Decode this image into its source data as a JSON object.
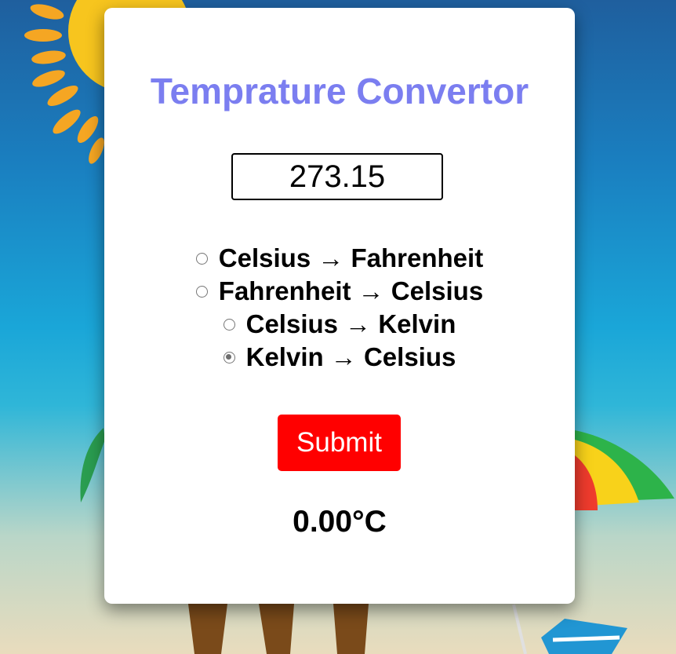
{
  "app": {
    "title": "Temprature Convertor"
  },
  "input": {
    "value": "273.15"
  },
  "options": [
    {
      "label": "Celsius → Fahrenheit",
      "checked": false
    },
    {
      "label": "Fahrenheit → Celsius",
      "checked": false
    },
    {
      "label": "Celsius → Kelvin",
      "checked": false
    },
    {
      "label": "Kelvin → Celsius",
      "checked": true
    }
  ],
  "submit": {
    "label": "Submit"
  },
  "result": {
    "text": "0.00°C"
  },
  "colors": {
    "title": "#7b7ef0",
    "submit_bg": "#ff0000",
    "card_bg": "#ffffff"
  }
}
